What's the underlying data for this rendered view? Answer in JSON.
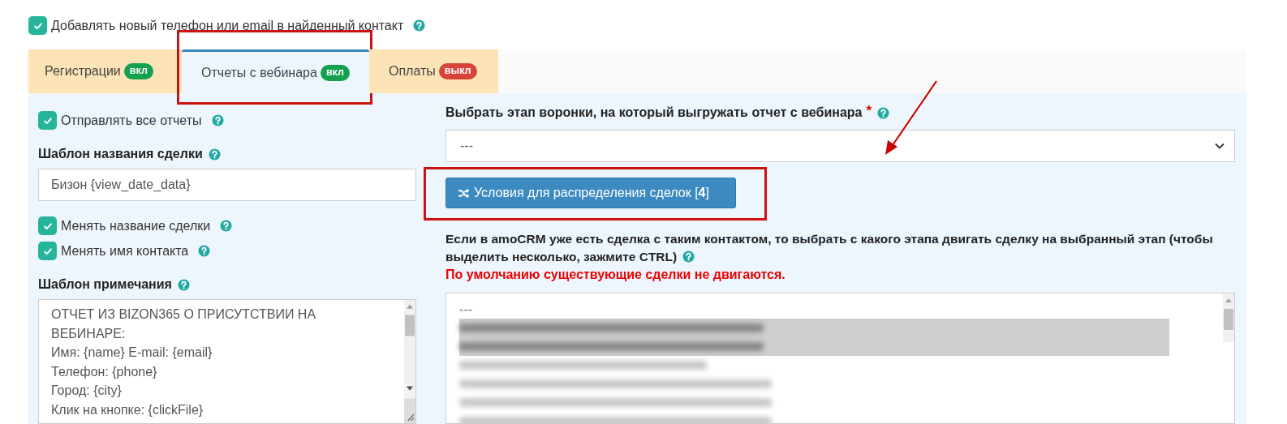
{
  "top_option": {
    "label": "Добавлять новый телефон или email в найденный контакт",
    "checked": true,
    "help": true
  },
  "tabs": [
    {
      "label": "Регистрации",
      "badge": "вкл",
      "enabled": true,
      "selected": false
    },
    {
      "label": "Отчеты с вебинара",
      "badge": "вкл",
      "enabled": true,
      "selected": true,
      "annotated": true
    },
    {
      "label": "Оплаты",
      "badge": "выкл",
      "enabled": false,
      "selected": false
    }
  ],
  "left": [
    {
      "kind": "checkbox",
      "label": "Отправлять все отчеты",
      "checked": true,
      "help": true
    },
    {
      "kind": "heading",
      "label": "Шаблон названия сделки",
      "help": true
    },
    {
      "kind": "input",
      "value": "Бизон {view_date_data}"
    },
    {
      "kind": "checkbox",
      "label": "Менять название сделки",
      "checked": true,
      "help": true
    },
    {
      "kind": "checkbox",
      "label": "Менять имя контакта",
      "checked": true,
      "help": true
    },
    {
      "kind": "heading",
      "label": "Шаблон примечания",
      "help": true
    },
    {
      "kind": "textarea",
      "value": "ОТЧЕТ ИЗ BIZON365 О ПРИСУТСТВИИ НА ВЕБИНАРЕ:\nИмя: {name} E-mail: {email}\nТелефон: {phone}\nГород: {city}\nКлик на кнопке: {clickFile}"
    }
  ],
  "right": [
    {
      "kind": "label",
      "label": "Выбрать этап воронки, на который выгружать отчет с вебинара",
      "required": "*",
      "help": true
    },
    {
      "kind": "select",
      "value": "---"
    },
    {
      "kind": "button",
      "label": "Условия для распределения сделок [",
      "count": "4",
      "suffix": "]",
      "annotated": true
    },
    {
      "kind": "paragraph",
      "label": "Если в amoCRM уже есть сделка с таким контактом, то выбрать с какого этапа двигать сделку на выбранный этап (чтобы выделить несколько, зажмите CTRL)",
      "help": true
    },
    {
      "kind": "warning",
      "label": "По умолчанию существующие сделки не двигаются."
    },
    {
      "kind": "listbox",
      "options": [
        {
          "kind": "text",
          "label": "---",
          "selected": false
        },
        {
          "kind": "redacted",
          "selected": true
        },
        {
          "kind": "redacted",
          "selected": true
        },
        {
          "kind": "redacted",
          "selected": false
        },
        {
          "kind": "redacted",
          "selected": false
        },
        {
          "kind": "redacted",
          "selected": false
        },
        {
          "kind": "redacted",
          "selected": false
        }
      ]
    }
  ],
  "annotations": [
    {
      "kind": "arrow"
    }
  ]
}
